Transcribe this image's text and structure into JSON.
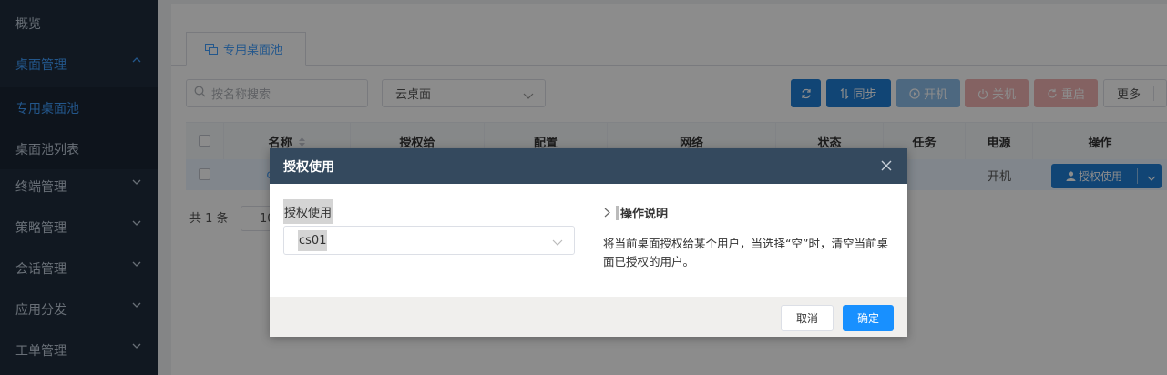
{
  "sidebar": {
    "items": [
      {
        "label": "概览"
      },
      {
        "label": "桌面管理"
      },
      {
        "label": "专用桌面池"
      },
      {
        "label": "桌面池列表"
      },
      {
        "label": "终端管理"
      },
      {
        "label": "策略管理"
      },
      {
        "label": "会话管理"
      },
      {
        "label": "应用分发"
      },
      {
        "label": "工单管理"
      }
    ]
  },
  "main": {
    "tab_label": "专用桌面池",
    "search_placeholder": "按名称搜索",
    "filter_select": "云桌面",
    "toolbar": {
      "sync_label": "同步",
      "power_on_label": "开机",
      "power_off_label": "关机",
      "restart_label": "重启",
      "more_label": "更多"
    },
    "table": {
      "columns": [
        "名称",
        "授权给",
        "配置",
        "网络",
        "状态",
        "任务",
        "电源",
        "操作"
      ],
      "row": {
        "name_fragment": "c",
        "power": "开机",
        "action_label": "授权使用"
      }
    },
    "pager": {
      "total_text": "共 1 条",
      "page_size_fragment": "10"
    }
  },
  "dialog": {
    "title": "授权使用",
    "field_label": "授权使用",
    "field_value": "cs01",
    "help_title": "操作说明",
    "help_text": "将当前桌面授权给某个用户，当选择“空”时，清空当前桌面已授权的用户。",
    "cancel_label": "取消",
    "ok_label": "确定"
  },
  "colors": {
    "accent": "#409eff",
    "primary_button": "#1f7ed6",
    "dialog_header": "#34495e",
    "sidebar": "#1f2d3d"
  }
}
